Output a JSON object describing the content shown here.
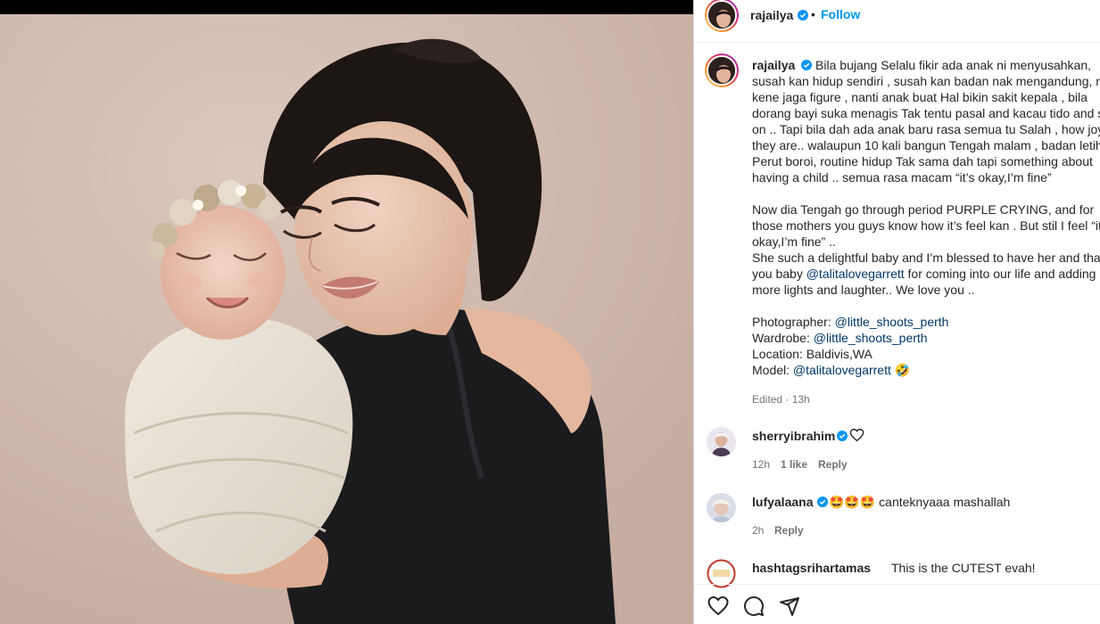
{
  "post": {
    "username": "rajailya",
    "follow_label": "Follow",
    "dot": "•",
    "caption_lines": [
      "Bila bujang Selalu fikir ada anak ni menyusahkan,",
      "susah kan hidup sendiri , susah kan badan nak mengandung, nak",
      "kene jaga figure , nanti anak buat Hal bikin sakit kepala , bila",
      "dorang bayi suka menagis Tak tentu pasal and kacau tido and so",
      "on .. Tapi bila dah ada anak baru rasa semua tu Salah , how joyful",
      "they are.. walaupun 10 kali bangun Tengah malam , badan letih ,",
      "Perut boroi, routine hidup Tak sama dah tapi something about",
      "having a child .. semua rasa macam “it’s okay,I’m fine”",
      "Now dia Tengah go through period PURPLE CRYING, and for",
      "those mothers you guys know how it’s feel kan . But stil I feel “it’s",
      "okay,I’m fine” ..",
      "She such a delightful baby and I’m blessed to have her and thank",
      "you baby ",
      "@talitalovegarrett",
      " for coming into our life and adding",
      "more lights and laughter.. We love you ..",
      "Photographer: ",
      "@little_shoots_perth",
      "Wardrobe: ",
      "@little_shoots_perth",
      "Location: Baldivis,WA",
      "Model: ",
      "@talitalovegarrett",
      " 🤣"
    ],
    "edited": "Edited · 13h"
  },
  "comments": [
    {
      "username": "sherryibrahim",
      "text": "",
      "time": "12h",
      "likes": "1 like",
      "reply": "Reply"
    },
    {
      "username": "lufyalaana",
      "text": "🤩🤩🤩 canteknyaaa mashallah",
      "time": "2h",
      "reply": "Reply"
    },
    {
      "username": "hashtagsrihartamas",
      "text": "This is the CUTEST evah!"
    }
  ],
  "icons": {
    "like": "heart-icon",
    "comment": "comment-icon",
    "share": "share-icon",
    "verified": "verified-badge-icon"
  },
  "colors": {
    "accent": "#0095f6",
    "mention": "#00376b",
    "verified": "#0095f6",
    "muted": "#737373"
  }
}
